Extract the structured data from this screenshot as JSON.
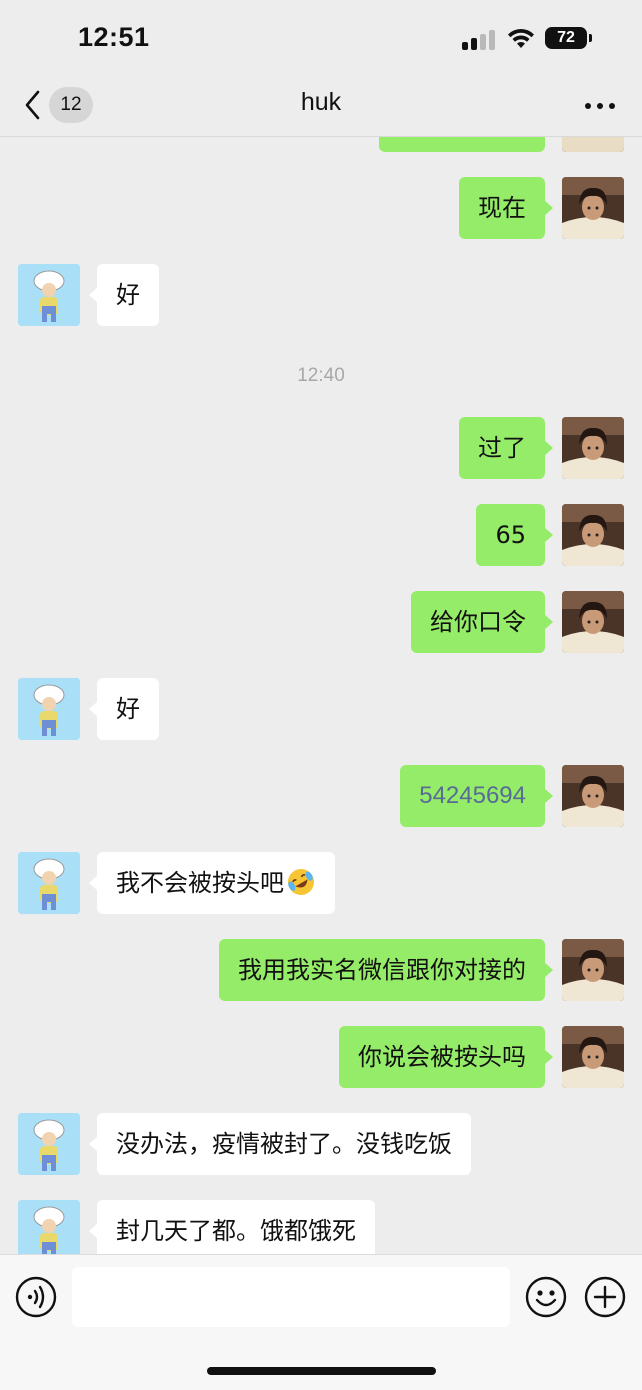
{
  "status_bar": {
    "time": "12:51",
    "battery": "72"
  },
  "nav": {
    "unread_count": "12",
    "title": "huk"
  },
  "messages": [
    {
      "side": "me",
      "text": ""
    },
    {
      "side": "me",
      "text": "现在"
    },
    {
      "side": "other",
      "text": "好"
    },
    {
      "type": "timestamp",
      "text": "12:40"
    },
    {
      "side": "me",
      "text": "过了"
    },
    {
      "side": "me",
      "text": "65"
    },
    {
      "side": "me",
      "text": "给你口令"
    },
    {
      "side": "other",
      "text": "好"
    },
    {
      "side": "me",
      "text": "54245694",
      "style": "number-link"
    },
    {
      "side": "other",
      "text": "我不会被按头吧",
      "emoji": "rolling-laughing-emoji"
    },
    {
      "side": "me",
      "text": "我用我实名微信跟你对接的"
    },
    {
      "side": "me",
      "text": "你说会被按头吗"
    },
    {
      "side": "other",
      "text": "没办法，疫情被封了。没钱吃饭"
    },
    {
      "side": "other",
      "text": "封几天了都。饿都饿死"
    }
  ],
  "input": {
    "placeholder": ""
  },
  "colors": {
    "my_bubble": "#95ec69",
    "other_bubble": "#ffffff",
    "background": "#ededed",
    "number_link": "#576b95"
  },
  "icons": [
    "back-chevron-icon",
    "more-icon",
    "voice-icon",
    "emoji-icon",
    "plus-icon"
  ]
}
